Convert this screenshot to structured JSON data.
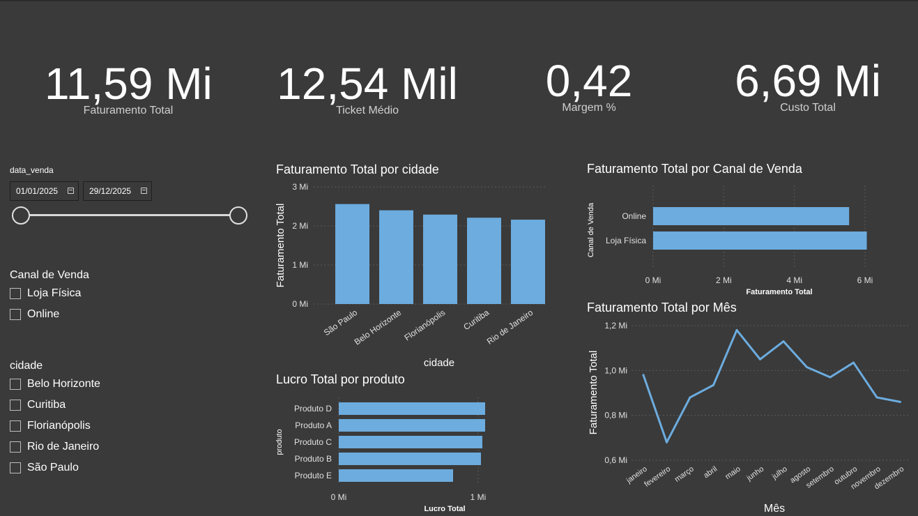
{
  "kpis": {
    "faturamento": {
      "value": "11,59 Mi",
      "label": "Faturamento Total"
    },
    "ticket": {
      "value": "12,54 Mil",
      "label": "Ticket Médio"
    },
    "margem": {
      "value": "0,42",
      "label": "Margem %"
    },
    "custo": {
      "value": "6,69 Mi",
      "label": "Custo Total"
    }
  },
  "date_slicer": {
    "title": "data_venda",
    "start": "01/01/2025",
    "end": "29/12/2025",
    "range": [
      0,
      1
    ]
  },
  "canal_slicer": {
    "title": "Canal de Venda",
    "items": [
      {
        "label": "Loja Física"
      },
      {
        "label": "Online"
      }
    ]
  },
  "cidade_slicer": {
    "title": "cidade",
    "items": [
      {
        "label": "Belo Horizonte"
      },
      {
        "label": "Curitiba"
      },
      {
        "label": "Florianópolis"
      },
      {
        "label": "Rio de Janeiro"
      },
      {
        "label": "São Paulo"
      }
    ]
  },
  "colors": {
    "bar": "#6cacdf",
    "background": "#3a3a3a",
    "grid": "#5a5a5a"
  },
  "chart_data": [
    {
      "id": "cidade",
      "type": "bar",
      "title": "Faturamento Total por cidade",
      "xlabel": "cidade",
      "ylabel": "Faturamento Total",
      "categories": [
        "São Paulo",
        "Belo Horizonte",
        "Florianópolis",
        "Curitiba",
        "Rio de Janeiro"
      ],
      "values": [
        2.56,
        2.4,
        2.29,
        2.21,
        2.16
      ],
      "yticks": [
        "0 Mi",
        "1 Mi",
        "2 Mi",
        "3 Mi"
      ],
      "ylim": [
        0,
        3
      ],
      "grid": true
    },
    {
      "id": "canal",
      "type": "bar",
      "orientation": "horizontal",
      "title": "Faturamento Total por Canal de Venda",
      "xlabel": "Faturamento Total",
      "ylabel": "Canal de Venda",
      "categories": [
        "Online",
        "Loja Física"
      ],
      "values": [
        5.55,
        6.05
      ],
      "xticks": [
        "0 Mi",
        "2 Mi",
        "4 Mi",
        "6 Mi"
      ],
      "xlim": [
        0,
        6
      ],
      "grid": true
    },
    {
      "id": "produto",
      "type": "bar",
      "orientation": "horizontal",
      "title": "Lucro Total por produto",
      "xlabel": "Lucro Total",
      "ylabel": "produto",
      "categories": [
        "Produto D",
        "Produto A",
        "Produto C",
        "Produto B",
        "Produto E"
      ],
      "values": [
        1.05,
        1.05,
        1.03,
        1.02,
        0.82
      ],
      "xticks": [
        "0 Mi",
        "1 Mi"
      ],
      "xlim": [
        0,
        1
      ],
      "grid": true
    },
    {
      "id": "mes",
      "type": "line",
      "title": "Faturamento Total por Mês",
      "xlabel": "Mês",
      "ylabel": "Faturamento Total",
      "categories": [
        "janeiro",
        "fevereiro",
        "março",
        "abril",
        "maio",
        "junho",
        "julho",
        "agosto",
        "setembro",
        "outubro",
        "novembro",
        "dezembro"
      ],
      "values": [
        0.98,
        0.68,
        0.88,
        0.935,
        1.18,
        1.05,
        1.13,
        1.015,
        0.97,
        1.035,
        0.88,
        0.86
      ],
      "yticks": [
        "0,6 Mi",
        "0,8 Mi",
        "1,0 Mi",
        "1,2 Mi"
      ],
      "ylim": [
        0.6,
        1.2
      ],
      "grid": true
    }
  ]
}
